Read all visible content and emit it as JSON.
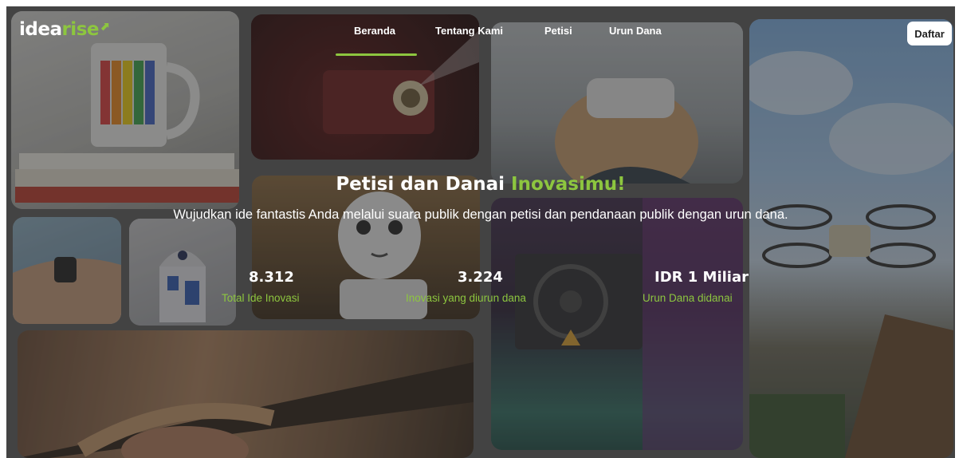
{
  "brand": {
    "logo_white": "idea",
    "logo_green": "rise",
    "logo_mark": "⬈",
    "accent": "#8dc63f"
  },
  "nav": {
    "items": [
      "Beranda",
      "Tentang Kami",
      "Petisi",
      "Urun Dana"
    ],
    "active": "Beranda",
    "register_label": "Daftar"
  },
  "hero": {
    "title_main": "Petisi dan Danai ",
    "title_accent": "Inovasimu!",
    "subtitle": "Wujudkan ide fantastis Anda melalui suara publik dengan petisi dan pendanaan publik dengan urun dana."
  },
  "stats": [
    {
      "value": "8.312",
      "label": "Total Ide Inovasi"
    },
    {
      "value": "3.224",
      "label": "Inovasi yang diurun dana"
    },
    {
      "value": "IDR 1 Miliar",
      "label": "Urun Dana didanai"
    }
  ],
  "background_photos": [
    "mug-photo",
    "projector-photo",
    "vr-headset-photo",
    "drone-photo",
    "smartwatch-photo",
    "r2d2-photo",
    "robot-photo",
    "3d-printer-photo",
    "guitar-photo"
  ]
}
